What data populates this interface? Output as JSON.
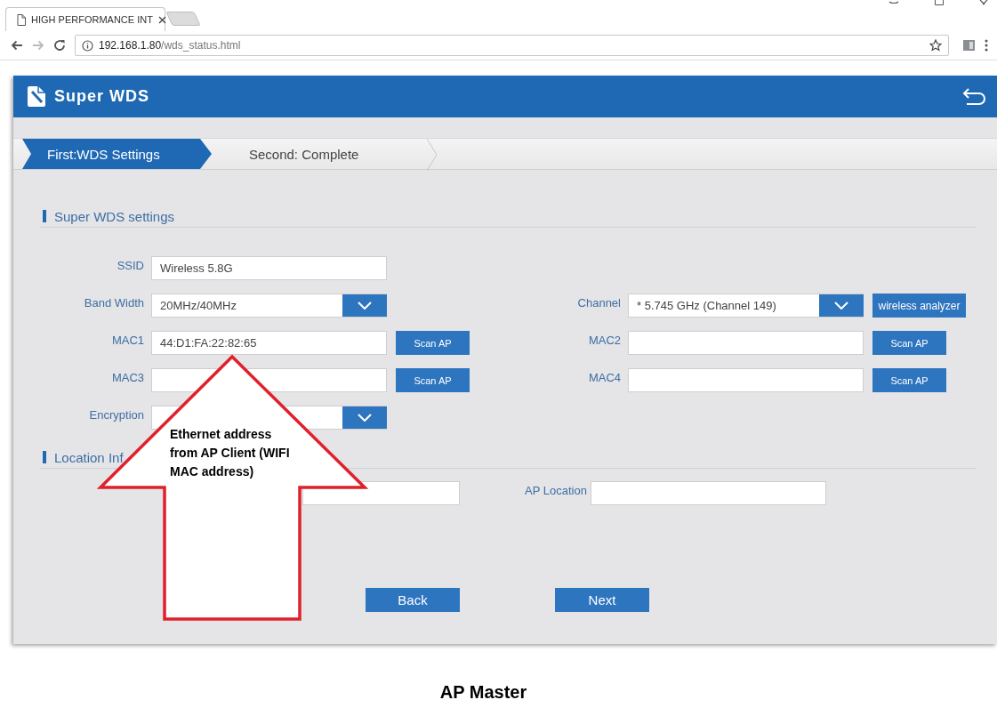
{
  "browser": {
    "tab_title": "HIGH PERFORMANCE INT",
    "address_host": "192.168.1.80",
    "address_path": "/wds_status.html"
  },
  "header": {
    "title": "Super WDS"
  },
  "steps": [
    {
      "label": "First:WDS Settings",
      "selected": true
    },
    {
      "label": "Second: Complete",
      "selected": false
    }
  ],
  "settings": {
    "title": "Super WDS settings",
    "rows": [
      {
        "left": {
          "label": "SSID",
          "kind": "text",
          "value": "Wireless 5.8G"
        }
      },
      {
        "left": {
          "label": "Band Width",
          "kind": "select",
          "value": "20MHz/40MHz"
        },
        "right": {
          "label": "Channel",
          "kind": "select",
          "value": "* 5.745 GHz (Channel 149)",
          "button": "wireless analyzer"
        }
      },
      {
        "left": {
          "label": "MAC1",
          "kind": "text",
          "value": "44:D1:FA:22:82:65",
          "button": "Scan AP"
        },
        "right": {
          "label": "MAC2",
          "kind": "text",
          "button": "Scan AP"
        }
      },
      {
        "left": {
          "label": "MAC3",
          "kind": "text",
          "button": "Scan AP"
        },
        "right": {
          "label": "MAC4",
          "kind": "text",
          "button": "Scan AP"
        }
      },
      {
        "left": {
          "label": "Encryption",
          "kind": "select"
        }
      }
    ]
  },
  "location": {
    "title": "Location Inf",
    "fields": [
      {
        "kind": "text"
      },
      {
        "label": "AP Location",
        "kind": "text"
      }
    ]
  },
  "buttons": [
    "Back",
    "Next"
  ],
  "annotation": {
    "text": "Ethernet address from AP Client (WIFI MAC address)"
  },
  "caption": "AP Master"
}
